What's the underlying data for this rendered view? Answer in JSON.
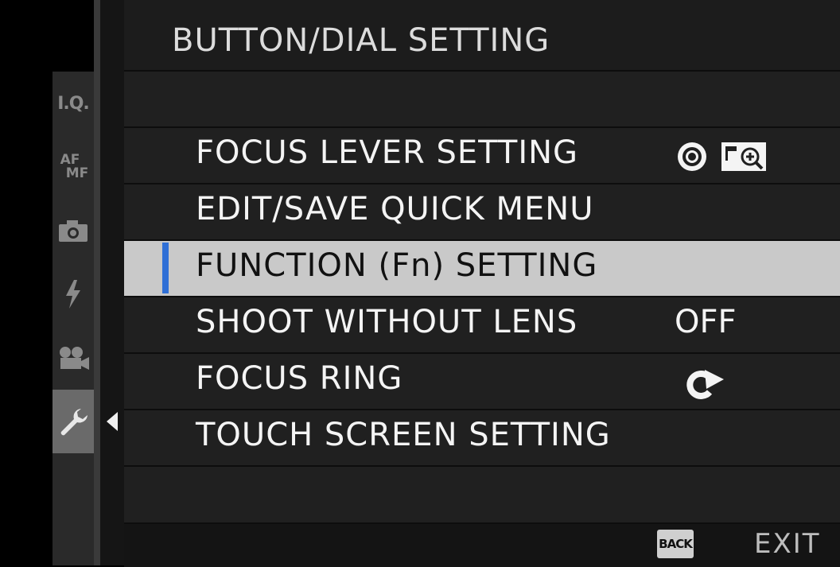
{
  "screen": {
    "title": "BUTTON/DIAL SETTING"
  },
  "tabs": [
    {
      "id": "iq",
      "label": "I.Q."
    },
    {
      "id": "afmf",
      "label_top": "AF",
      "label_bottom": "MF"
    },
    {
      "id": "shooting",
      "icon": "camera-icon"
    },
    {
      "id": "flash",
      "icon": "flash-icon"
    },
    {
      "id": "movie",
      "icon": "movie-icon"
    },
    {
      "id": "setup",
      "icon": "wrench-icon",
      "active": true
    }
  ],
  "menu": {
    "items": [
      {
        "label": "FOCUS LEVER SETTING",
        "value_icons": [
          "joystick-icon",
          "focus-zoom-icon"
        ]
      },
      {
        "label": "EDIT/SAVE QUICK MENU",
        "value": ""
      },
      {
        "label": "FUNCTION (Fn) SETTING",
        "value": "",
        "selected": true
      },
      {
        "label": "SHOOT WITHOUT LENS",
        "value": "OFF"
      },
      {
        "label": "FOCUS RING",
        "value_icons": [
          "rotate-clockwise-icon"
        ]
      },
      {
        "label": "TOUCH SCREEN SETTING",
        "value": ""
      }
    ]
  },
  "footer": {
    "back_label": "BACK",
    "exit_label": "EXIT"
  },
  "colors": {
    "selection_marker": "#2f6fd6",
    "selected_row": "#c9c9c9",
    "background": "#1c1c1c"
  }
}
